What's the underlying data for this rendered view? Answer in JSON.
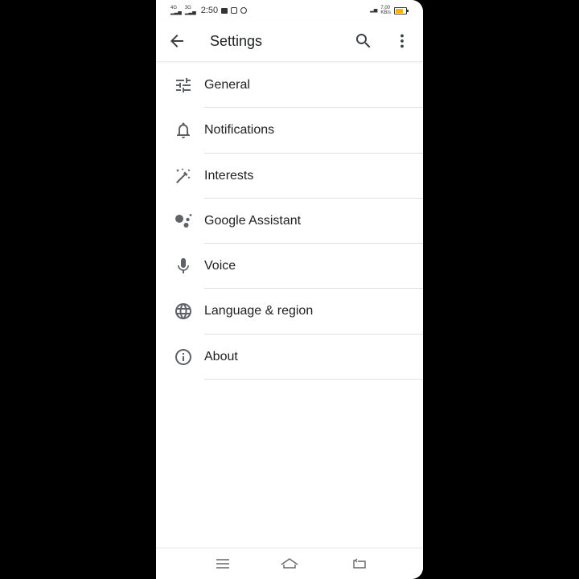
{
  "status_bar": {
    "network_top": "4G",
    "network_bottom": "3G",
    "time": "2:50",
    "speed_top": "7.00",
    "speed_bottom": "KB/s"
  },
  "app_bar": {
    "title": "Settings",
    "icons": [
      "back-arrow-icon",
      "search-icon",
      "more-vert-icon"
    ]
  },
  "settings_items": [
    {
      "label": "General",
      "icon": "tune-icon"
    },
    {
      "label": "Notifications",
      "icon": "bell-icon"
    },
    {
      "label": "Interests",
      "icon": "magic-wand-icon"
    },
    {
      "label": "Google Assistant",
      "icon": "assistant-icon"
    },
    {
      "label": "Voice",
      "icon": "microphone-icon"
    },
    {
      "label": "Language & region",
      "icon": "globe-icon"
    },
    {
      "label": "About",
      "icon": "info-icon"
    }
  ],
  "nav_bar": {
    "icons": [
      "menu-icon",
      "home-icon",
      "back-icon"
    ]
  },
  "colors": {
    "text": "#202124",
    "icon": "#5f6368",
    "divider": "#e0e0e0",
    "background": "#ffffff"
  }
}
